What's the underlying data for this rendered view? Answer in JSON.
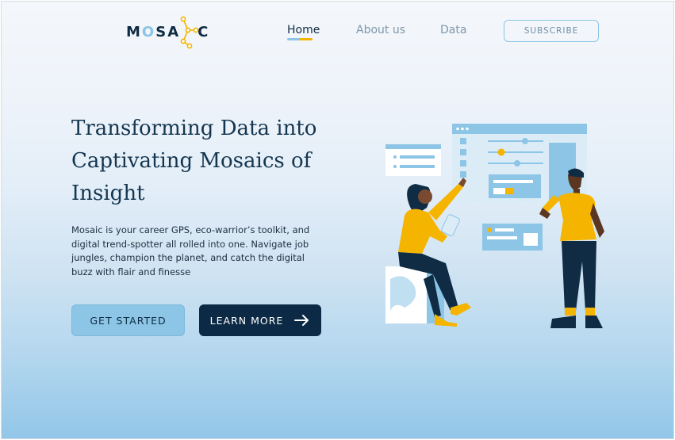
{
  "brand": {
    "name_left": "M",
    "name_o": "O",
    "name_mid": "SA",
    "name_right": "C"
  },
  "nav": {
    "items": [
      {
        "label": "Home",
        "active": true
      },
      {
        "label": "About us",
        "active": false
      },
      {
        "label": "Data",
        "active": false
      }
    ],
    "subscribe_label": "SUBSCRIBE"
  },
  "hero": {
    "headline": "Transforming Data into Captivating Mosaics of Insight",
    "description": "Mosaic is your career GPS, eco-warrior’s toolkit, and digital trend-spotter all rolled into one. Navigate job jungles, champion the planet, and catch the digital buzz with flair and finesse",
    "primary_button": "GET STARTED",
    "secondary_button": "LEARN MORE",
    "secondary_icon": "arrow-right-icon"
  },
  "colors": {
    "navy": "#0c2a45",
    "sky": "#8cc5e5",
    "accent_yellow": "#f5b400"
  }
}
